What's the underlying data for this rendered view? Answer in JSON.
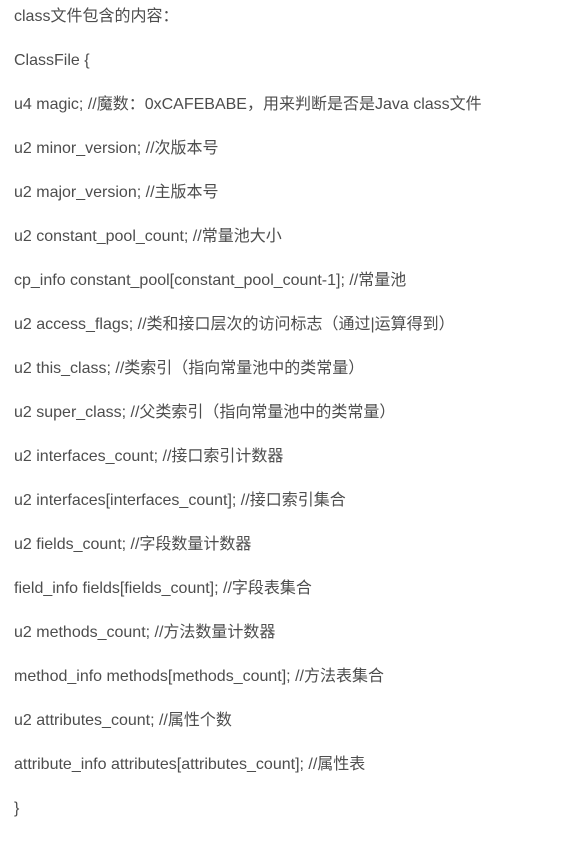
{
  "lines": [
    "class文件包含的内容：",
    "ClassFile {",
    "u4 magic; //魔数：0xCAFEBABE，用来判断是否是Java class文件",
    "u2 minor_version; //次版本号",
    "u2 major_version; //主版本号",
    "u2 constant_pool_count; //常量池大小",
    "cp_info constant_pool[constant_pool_count-1]; //常量池",
    "u2 access_flags; //类和接口层次的访问标志（通过|运算得到）",
    "u2 this_class; //类索引（指向常量池中的类常量）",
    "u2 super_class; //父类索引（指向常量池中的类常量）",
    "u2 interfaces_count; //接口索引计数器",
    "u2 interfaces[interfaces_count]; //接口索引集合",
    "u2 fields_count; //字段数量计数器",
    "field_info fields[fields_count]; //字段表集合",
    "u2 methods_count; //方法数量计数器",
    "method_info methods[methods_count]; //方法表集合",
    "u2 attributes_count; //属性个数",
    "attribute_info attributes[attributes_count]; //属性表",
    "}"
  ]
}
